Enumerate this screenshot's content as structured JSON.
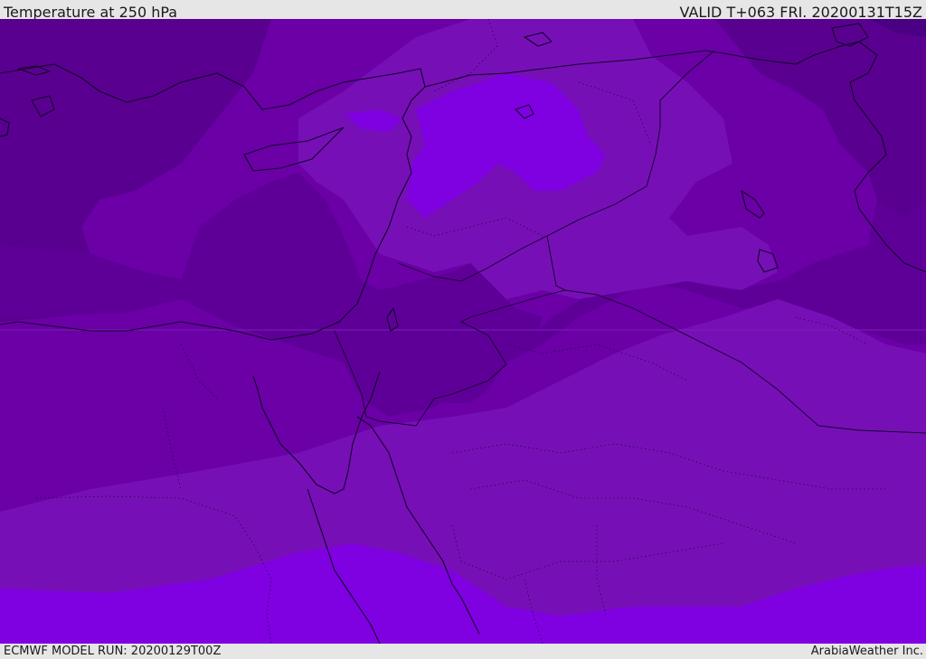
{
  "header": {
    "title": "Temperature at 250 hPa",
    "valid_time": "VALID T+063 FRI. 20200131T15Z"
  },
  "footer": {
    "model_run": "ECMWF MODEL RUN: 20200129T00Z",
    "credit": "ArabiaWeather Inc."
  },
  "map": {
    "field": "temperature",
    "level_hpa": 250,
    "colors": {
      "coldest": "#4a0082",
      "cold": "#5a008f",
      "mid": "#6a00a6",
      "warm": "#7a10b8",
      "warmer": "#8000d0",
      "warmest": "#7f00e0",
      "border_line": "#1a0030"
    }
  }
}
